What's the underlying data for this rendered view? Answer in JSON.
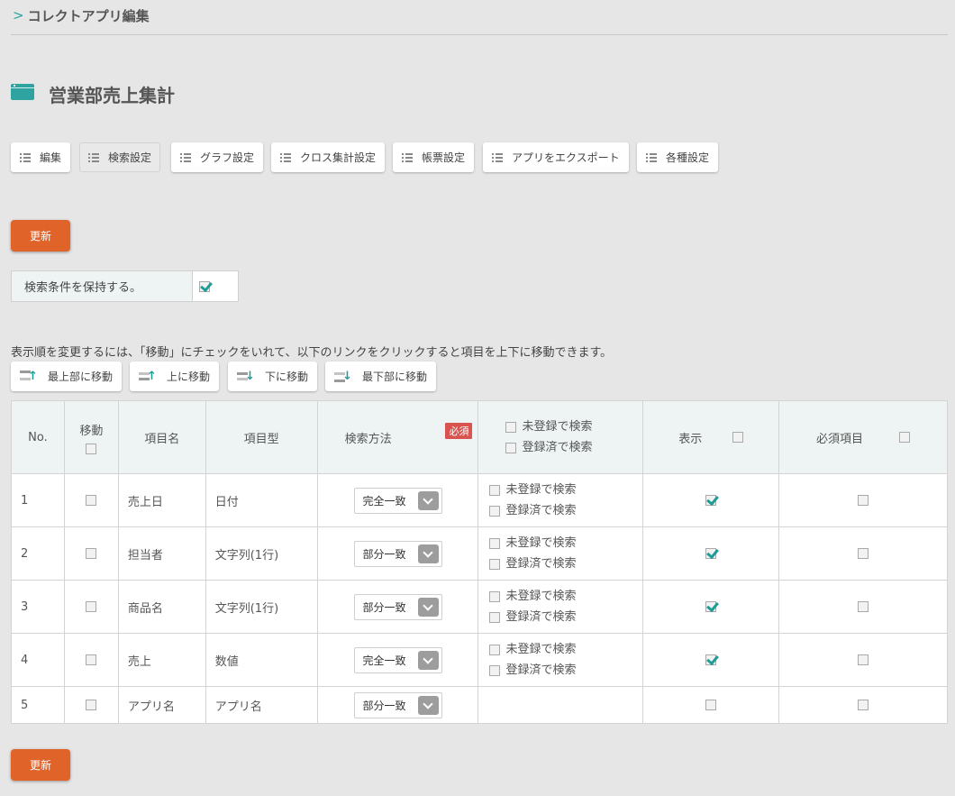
{
  "breadcrumb": {
    "text": "コレクトアプリ編集"
  },
  "page": {
    "title": "営業部売上集計"
  },
  "tabs": [
    {
      "label": "編集"
    },
    {
      "label": "検索設定"
    },
    {
      "label": "グラフ設定"
    },
    {
      "label": "クロス集計設定"
    },
    {
      "label": "帳票設定"
    },
    {
      "label": "アプリをエクスポート"
    },
    {
      "label": "各種設定"
    }
  ],
  "buttons": {
    "update": "更新"
  },
  "keep_condition": {
    "label": "検索条件を保持する。",
    "checked": true
  },
  "instruction": "表示順を変更するには、「移動」にチェックをいれて、以下のリンクをクリックすると項目を上下に移動できます。",
  "move_buttons": [
    {
      "label": "最上部に移動"
    },
    {
      "label": "上に移動"
    },
    {
      "label": "下に移動"
    },
    {
      "label": "最下部に移動"
    }
  ],
  "table": {
    "headers": {
      "no": "No.",
      "move": "移動",
      "item_name": "項目名",
      "item_type": "項目型",
      "search_method": "検索方法",
      "required_tag": "必須",
      "search_unregistered": "未登録で検索",
      "search_registered": "登録済で検索",
      "display": "表示",
      "required_item": "必須項目"
    },
    "rows": [
      {
        "no": "1",
        "name": "売上日",
        "type": "日付",
        "method": "完全一致",
        "display": true,
        "required": false
      },
      {
        "no": "2",
        "name": "担当者",
        "type": "文字列(1行)",
        "method": "部分一致",
        "display": true,
        "required": false
      },
      {
        "no": "3",
        "name": "商品名",
        "type": "文字列(1行)",
        "method": "部分一致",
        "display": true,
        "required": false
      },
      {
        "no": "4",
        "name": "売上",
        "type": "数値",
        "method": "完全一致",
        "display": true,
        "required": false
      },
      {
        "no": "5",
        "name": "アプリ名",
        "type": "アプリ名",
        "method": "部分一致",
        "display": false,
        "required": false
      }
    ],
    "row_options": {
      "unregistered": "未登録で検索",
      "registered": "登録済で検索"
    }
  },
  "colors": {
    "accent": "#2ea3a0",
    "update_button": "#e0642a",
    "required_tag": "#d9534f"
  }
}
